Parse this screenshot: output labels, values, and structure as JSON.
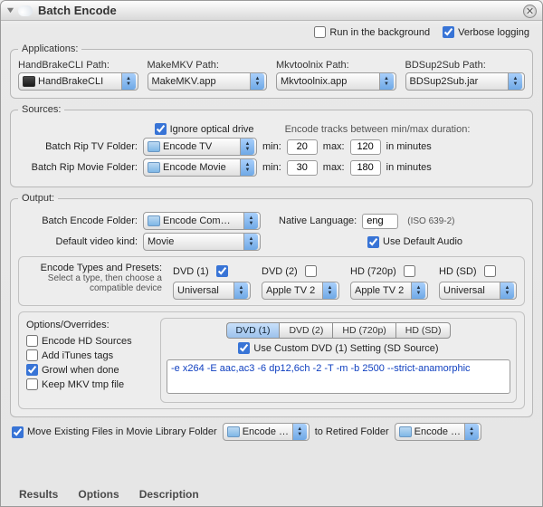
{
  "title": "Batch Encode",
  "top": {
    "runbg": "Run in the background",
    "verbose": "Verbose logging"
  },
  "applications": {
    "legend": "Applications:",
    "cols": [
      {
        "label": "HandBrakeCLI Path:",
        "value": "HandBrakeCLI"
      },
      {
        "label": "MakeMKV Path:",
        "value": "MakeMKV.app"
      },
      {
        "label": "Mkvtoolnix Path:",
        "value": "Mkvtoolnix.app"
      },
      {
        "label": "BDSup2Sub Path:",
        "value": "BDSup2Sub.jar"
      }
    ]
  },
  "sources": {
    "legend": "Sources:",
    "ignore": "Ignore optical drive",
    "rangehint": "Encode tracks between min/max duration:",
    "tvlabel": "Batch Rip TV Folder:",
    "tvfolder": "Encode TV",
    "tvmin": "20",
    "tvmax": "120",
    "movielabel": "Batch Rip Movie Folder:",
    "moviefolder": "Encode Movie",
    "moviemin": "30",
    "moviemax": "180",
    "min": "min:",
    "max": "max:",
    "inmin": "in minutes"
  },
  "output": {
    "legend": "Output:",
    "enclabel": "Batch Encode Folder:",
    "encfolder": "Encode Com…",
    "natlabel": "Native Language:",
    "natval": "eng",
    "iso": "(ISO 639-2)",
    "kindlabel": "Default video kind:",
    "kindval": "Movie",
    "defaudio": "Use Default Audio",
    "presetslabel": "Encode Types and Presets:",
    "presetshint": "Select a type, then choose a compatible device",
    "cols": [
      {
        "head": "DVD (1)",
        "checked": true,
        "popup": "Universal"
      },
      {
        "head": "DVD (2)",
        "checked": false,
        "popup": "Apple TV 2"
      },
      {
        "head": "HD (720p)",
        "checked": false,
        "popup": "Apple TV 2"
      },
      {
        "head": "HD (SD)",
        "checked": false,
        "popup": "Universal"
      }
    ]
  },
  "options": {
    "legend": "Options/Overrides:",
    "left": [
      {
        "label": "Encode HD Sources",
        "checked": false
      },
      {
        "label": "Add iTunes tags",
        "checked": false
      },
      {
        "label": "Growl when done",
        "checked": true
      },
      {
        "label": "Keep MKV tmp file",
        "checked": false
      }
    ],
    "segs": [
      "DVD (1)",
      "DVD (2)",
      "HD (720p)",
      "HD (SD)"
    ],
    "segsel": 0,
    "usecustom": "Use Custom DVD (1) Setting (SD Source)",
    "cmd": "-e x264 -E aac,ac3 -6 dp12,6ch -2 -T -m -b 2500 --strict-anamorphic"
  },
  "move": {
    "label1": "Move Existing Files in Movie Library Folder",
    "popup1": "Encode …",
    "tolabel": "to Retired Folder",
    "popup2": "Encode …"
  },
  "tabs": [
    "Results",
    "Options",
    "Description"
  ]
}
